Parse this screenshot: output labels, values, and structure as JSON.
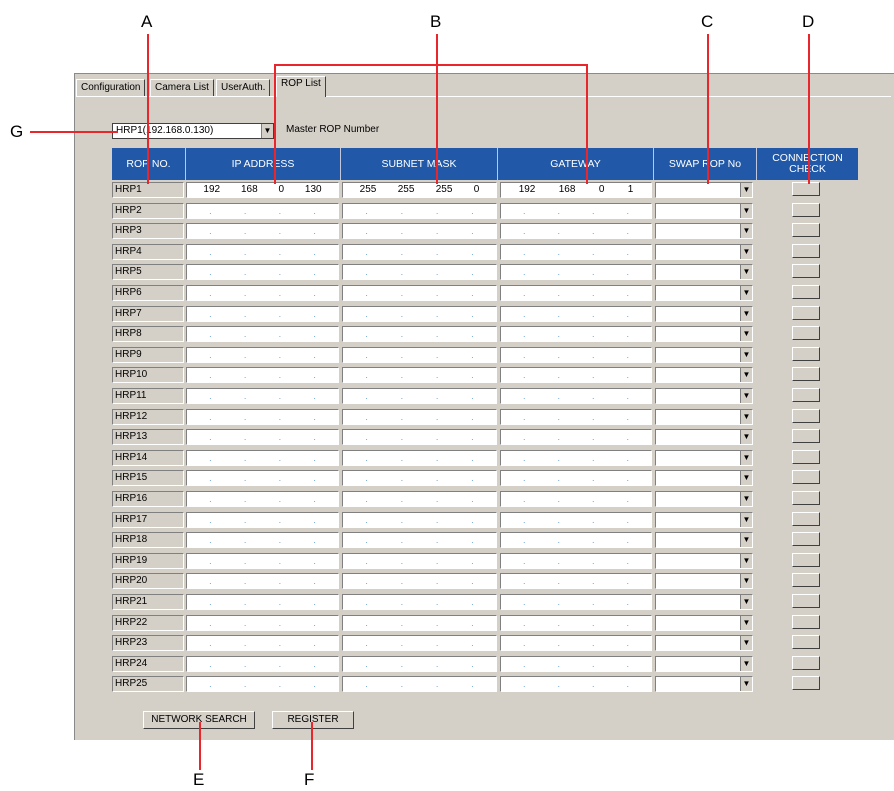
{
  "tabs": [
    "Configuration",
    "Camera List",
    "UserAuth.",
    "ROP List"
  ],
  "master": {
    "value": "HRP1(192.168.0.130)",
    "label": "Master ROP Number"
  },
  "headers": {
    "rop_no": "ROP NO.",
    "ip_address": "IP ADDRESS",
    "subnet_mask": "SUBNET MASK",
    "gateway": "GATEWAY",
    "swap_rop_no": "SWAP ROP No",
    "connection_check": "CONNECTION CHECK"
  },
  "rows": [
    {
      "name": "HRP1",
      "ip": [
        "192",
        "168",
        "0",
        "130"
      ],
      "mask": [
        "255",
        "255",
        "255",
        "0"
      ],
      "gw": [
        "192",
        "168",
        "0",
        "1"
      ]
    },
    {
      "name": "HRP2"
    },
    {
      "name": "HRP3"
    },
    {
      "name": "HRP4"
    },
    {
      "name": "HRP5"
    },
    {
      "name": "HRP6"
    },
    {
      "name": "HRP7"
    },
    {
      "name": "HRP8"
    },
    {
      "name": "HRP9"
    },
    {
      "name": "HRP10"
    },
    {
      "name": "HRP11"
    },
    {
      "name": "HRP12"
    },
    {
      "name": "HRP13"
    },
    {
      "name": "HRP14"
    },
    {
      "name": "HRP15"
    },
    {
      "name": "HRP16"
    },
    {
      "name": "HRP17"
    },
    {
      "name": "HRP18"
    },
    {
      "name": "HRP19"
    },
    {
      "name": "HRP20"
    },
    {
      "name": "HRP21"
    },
    {
      "name": "HRP22"
    },
    {
      "name": "HRP23"
    },
    {
      "name": "HRP24"
    },
    {
      "name": "HRP25"
    }
  ],
  "buttons": {
    "network_search": "NETWORK SEARCH",
    "register": "REGISTER"
  },
  "callouts": {
    "a": "A",
    "b": "B",
    "c": "C",
    "d": "D",
    "e": "E",
    "f": "F",
    "g": "G"
  },
  "colors": {
    "header_bg": "#2159a8",
    "callout_line": "#e8262c",
    "window_bg": "#d4d0c8"
  }
}
